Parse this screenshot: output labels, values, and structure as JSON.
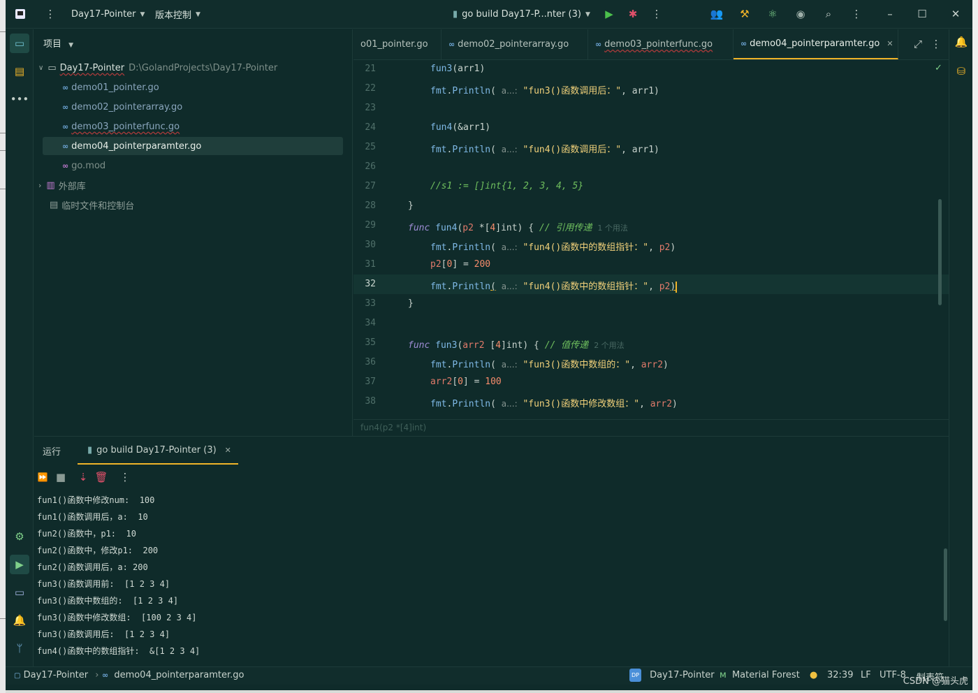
{
  "titlebar": {
    "project": "Day17-Pointer",
    "vcs": "版本控制",
    "run_config": "go build Day17-P...nter (3)"
  },
  "project_panel": {
    "title": "项目",
    "root_name": "Day17-Pointer",
    "root_path": "D:\\GolandProjects\\Day17-Pointer",
    "files": [
      "demo01_pointer.go",
      "demo02_pointerarray.go",
      "demo03_pointerfunc.go",
      "demo04_pointerparamter.go",
      "go.mod"
    ],
    "external_libs": "外部库",
    "scratches": "临时文件和控制台"
  },
  "tabs": [
    "o01_pointer.go",
    "demo02_pointerarray.go",
    "demo03_pointerfunc.go",
    "demo04_pointerparamter.go"
  ],
  "editor": {
    "line_numbers": [
      "21",
      "22",
      "23",
      "24",
      "25",
      "26",
      "27",
      "28",
      "29",
      "30",
      "31",
      "32",
      "33",
      "34",
      "35",
      "36",
      "37",
      "38"
    ],
    "hint": "a...:",
    "usage_1": "1 个用法",
    "usage_2": "2 个用法",
    "comment_27": "//s1 := []int{1, 2, 3, 4, 5}",
    "comment_29": "// 引用传递",
    "comment_35": "// 值传递",
    "str_22": "\"fun3()函数调用后：\"",
    "str_25": "\"fun4()函数调用后：\"",
    "str_30": "\"fun4()函数中的数组指针：\"",
    "str_32": "\"fun4()函数中的数组指针：\"",
    "str_36": "\"fun3()函数中数组的：\"",
    "str_38": "\"fun3()函数中修改数组：\"",
    "breadcrumb": "fun4(p2 *[4]int)"
  },
  "run": {
    "label": "运行",
    "tab": "go build Day17-Pointer (3)",
    "output": [
      "fun1()函数中修改num:  100",
      "fun1()函数调用后，a:  10",
      "fun2()函数中，p1:  10",
      "fun2()函数中，修改p1:  200",
      "fun2()函数调用后，a: 200",
      "fun3()函数调用前:  [1 2 3 4]",
      "fun3()函数中数组的:  [1 2 3 4]",
      "fun3()函数中修改数组:  [100 2 3 4]",
      "fun3()函数调用后:  [1 2 3 4]",
      "fun4()函数中的数组指针:  &[1 2 3 4]"
    ]
  },
  "status": {
    "project": "Day17-Pointer",
    "file": "demo04_pointerparamter.go",
    "badge": "DP",
    "module": "Day17-Pointer",
    "theme": "Material Forest",
    "position": "32:39",
    "line_sep": "LF",
    "encoding": "UTF-8",
    "indent": "制表符"
  },
  "watermark": "CSDN @猫头虎"
}
